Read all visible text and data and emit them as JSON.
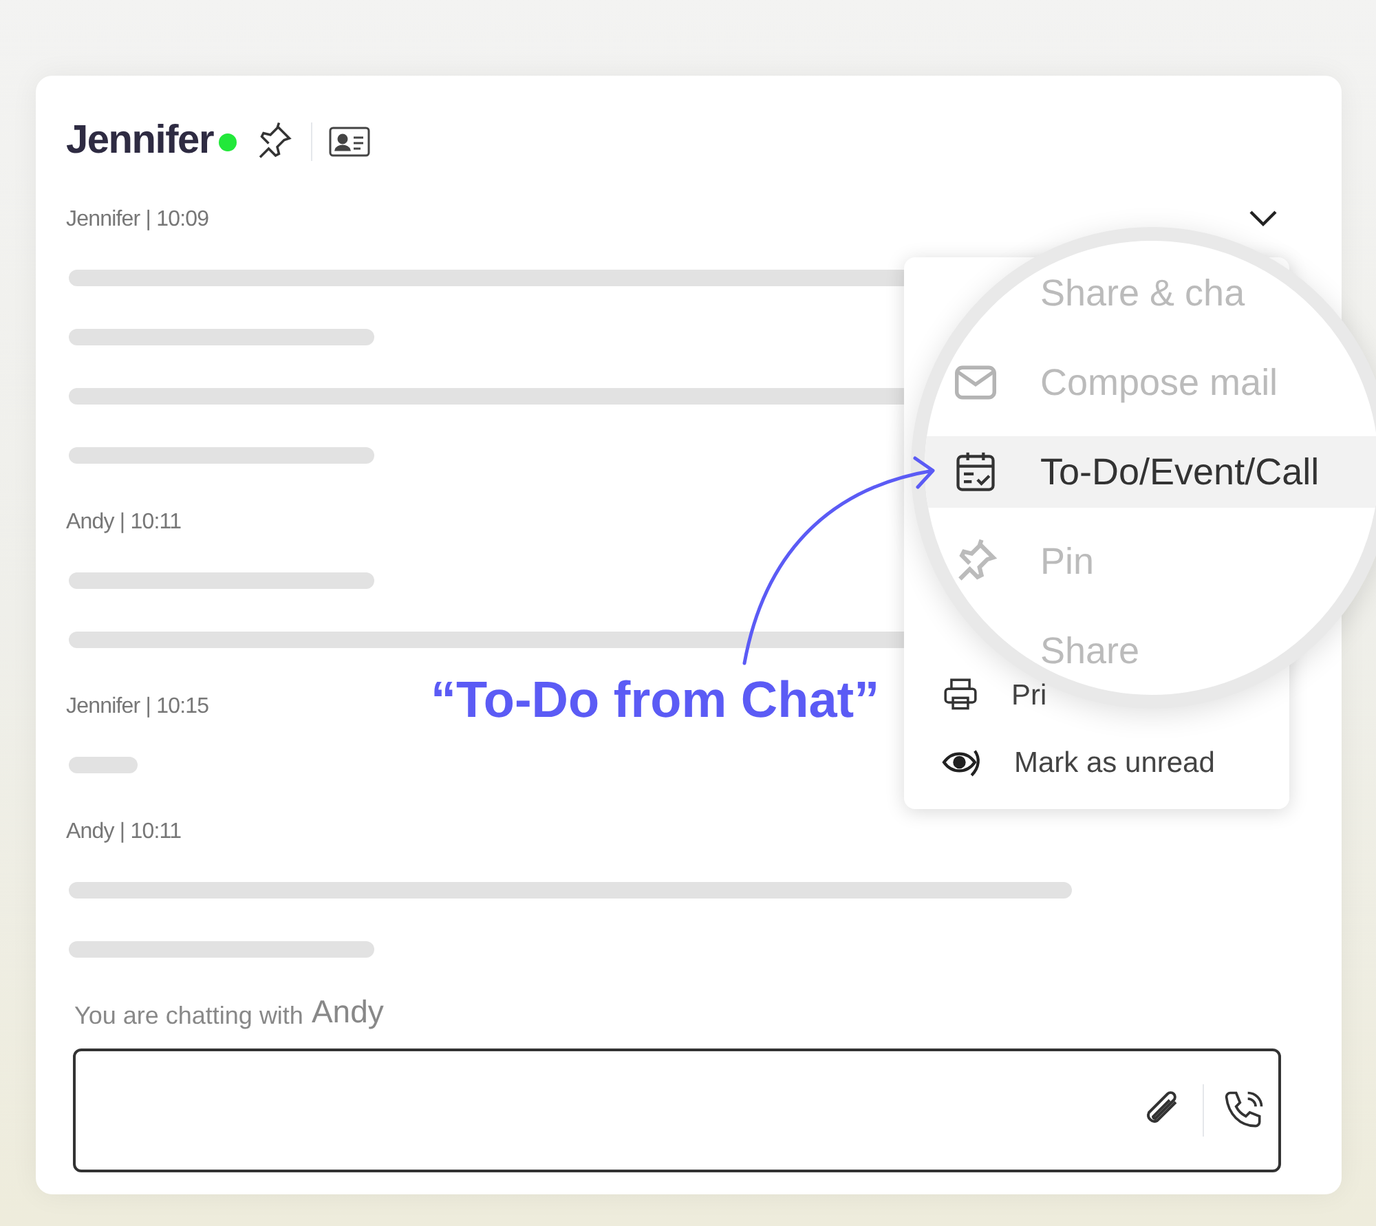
{
  "header": {
    "name": "Jennifer",
    "online": true
  },
  "messages": [
    {
      "author": "Jennifer | 10:09",
      "lines": [
        {
          "kind": "long"
        },
        {
          "kind": "short"
        },
        {
          "kind": "long"
        },
        {
          "kind": "short"
        }
      ]
    },
    {
      "author": "Andy | 10:11",
      "lines": [
        {
          "kind": "short"
        },
        {
          "kind": "long"
        }
      ]
    },
    {
      "author": "Jennifer | 10:15",
      "lines": [
        {
          "kind": "tiny"
        }
      ]
    },
    {
      "author": "Andy | 10:11",
      "lines": [
        {
          "kind": "medium"
        },
        {
          "kind": "short"
        }
      ]
    }
  ],
  "menu": {
    "items": [
      {
        "label": "Pri",
        "kind": "printer"
      },
      {
        "label": "Mark as unread",
        "kind": "eye"
      }
    ]
  },
  "magnifier": {
    "items": [
      {
        "label": "Share & cha",
        "kind": "share",
        "blurred": true,
        "selected": false
      },
      {
        "label": "Compose mail",
        "kind": "mail",
        "blurred": true,
        "selected": false
      },
      {
        "label": "To-Do/Event/Call",
        "kind": "calendar",
        "blurred": false,
        "selected": true
      },
      {
        "label": "Pin",
        "kind": "pin",
        "blurred": true,
        "selected": false
      },
      {
        "label": "Share",
        "kind": "plain",
        "blurred": true,
        "selected": false
      }
    ]
  },
  "annotation": "“To-Do from Chat”",
  "footer": {
    "prefix": "You are chatting with",
    "contact": "Andy"
  }
}
